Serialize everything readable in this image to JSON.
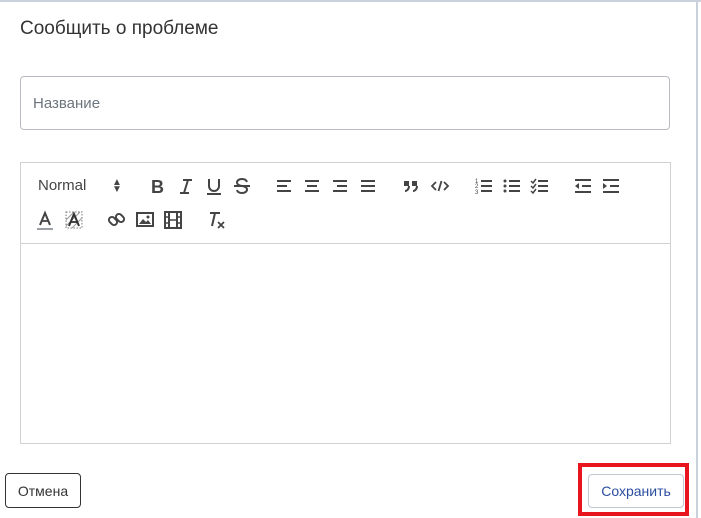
{
  "dialog": {
    "title": "Сообщить о проблеме"
  },
  "name_field": {
    "placeholder": "Название",
    "value": ""
  },
  "editor": {
    "header_picker": "Normal",
    "content": "",
    "toolbar_icons": [
      "bold-icon",
      "italic-icon",
      "underline-icon",
      "strikethrough-icon",
      "align-left-icon",
      "align-center-icon",
      "align-right-icon",
      "align-justify-icon",
      "blockquote-icon",
      "code-block-icon",
      "ordered-list-icon",
      "bullet-list-icon",
      "checklist-icon",
      "outdent-icon",
      "indent-icon",
      "text-color-icon",
      "background-color-icon",
      "link-icon",
      "image-icon",
      "video-icon",
      "clear-format-icon"
    ]
  },
  "footer": {
    "cancel_label": "Отмена",
    "save_label": "Сохранить"
  },
  "colors": {
    "highlight": "#e8141e",
    "save_text": "#2c4ea0",
    "border": "#b8bcc2"
  }
}
